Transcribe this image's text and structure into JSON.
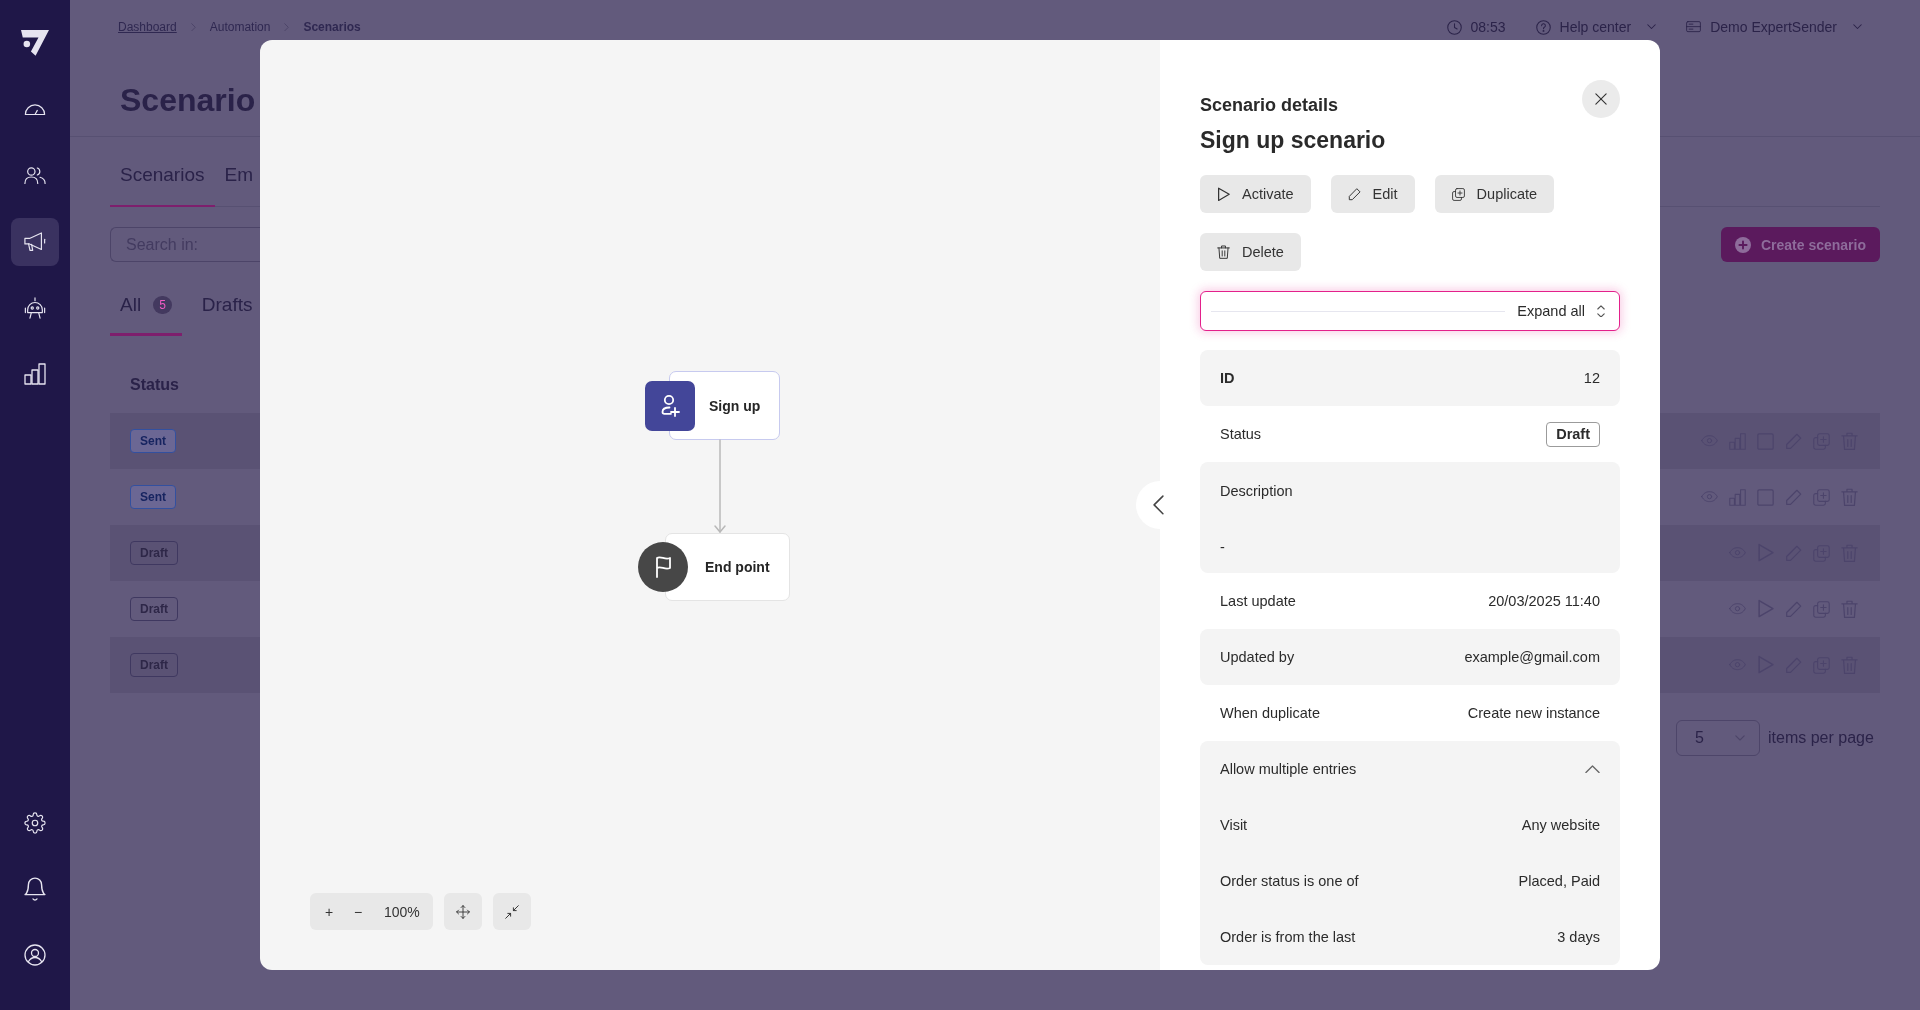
{
  "sidebar": {
    "items": [
      {
        "selected": false
      },
      {
        "selected": false
      },
      {
        "selected": true
      },
      {
        "selected": false
      },
      {
        "selected": false
      }
    ]
  },
  "topbar": {
    "breadcrumbs": [
      {
        "label": "Dashboard",
        "kind": "link"
      },
      {
        "label": "Automation",
        "kind": "plain"
      },
      {
        "label": "Scenarios",
        "kind": "current"
      }
    ],
    "time": "08:53",
    "help": "Help center",
    "account": "Demo ExpertSender"
  },
  "page": {
    "title": "Scenario",
    "tabs": [
      {
        "label": "Scenarios",
        "selected": true
      },
      {
        "label": "Em",
        "selected": false
      }
    ],
    "search": {
      "placeholder": "Search in:"
    },
    "create_button": "Create scenario",
    "filters": [
      {
        "label": "All",
        "count": "5",
        "selected": true
      },
      {
        "label": "Drafts",
        "selected": false
      }
    ],
    "table": {
      "columns": [
        "Status"
      ],
      "rows": [
        {
          "status": "Sent",
          "kind": "sent"
        },
        {
          "status": "Sent",
          "kind": "sent"
        },
        {
          "status": "Draft",
          "kind": "draft"
        },
        {
          "status": "Draft",
          "kind": "draft"
        },
        {
          "status": "Draft",
          "kind": "draft"
        }
      ]
    },
    "pagination": {
      "page_size": "5",
      "label": "items per page"
    }
  },
  "modal": {
    "canvas": {
      "nodes": [
        {
          "kind": "trigger",
          "label": "Sign up"
        },
        {
          "kind": "end",
          "label": "End point"
        }
      ],
      "zoom_in": "+",
      "zoom_out": "−",
      "zoom": "100%"
    },
    "panel": {
      "heading": "Scenario details",
      "title": "Sign up scenario",
      "actions": [
        {
          "label": "Activate",
          "kind": "activate"
        },
        {
          "label": "Edit",
          "kind": "edit"
        },
        {
          "label": "Duplicate",
          "kind": "duplicate"
        },
        {
          "label": "Delete",
          "kind": "delete"
        }
      ],
      "expand": {
        "label": "Expand all",
        "focused": true
      },
      "details": [
        {
          "label": "ID",
          "value": "12",
          "kind": "id"
        },
        {
          "label": "Status",
          "value": "Draft",
          "kind": "badge"
        },
        {
          "label": "Description",
          "value": "-",
          "kind": "block"
        },
        {
          "label": "Last update",
          "value": "20/03/2025 11:40",
          "kind": "text"
        },
        {
          "label": "Updated by",
          "value": "example@gmail.com",
          "kind": "text"
        },
        {
          "label": "When duplicate",
          "value": "Create new instance",
          "kind": "text"
        },
        {
          "label": "Allow multiple entries",
          "kind": "group",
          "expanded": true,
          "children": [
            {
              "label": "Visit",
              "value": "Any website"
            },
            {
              "label": "Order status is one of",
              "value": "Placed, Paid"
            },
            {
              "label": "Order is from the last",
              "value": "3 days"
            }
          ]
        }
      ]
    }
  }
}
